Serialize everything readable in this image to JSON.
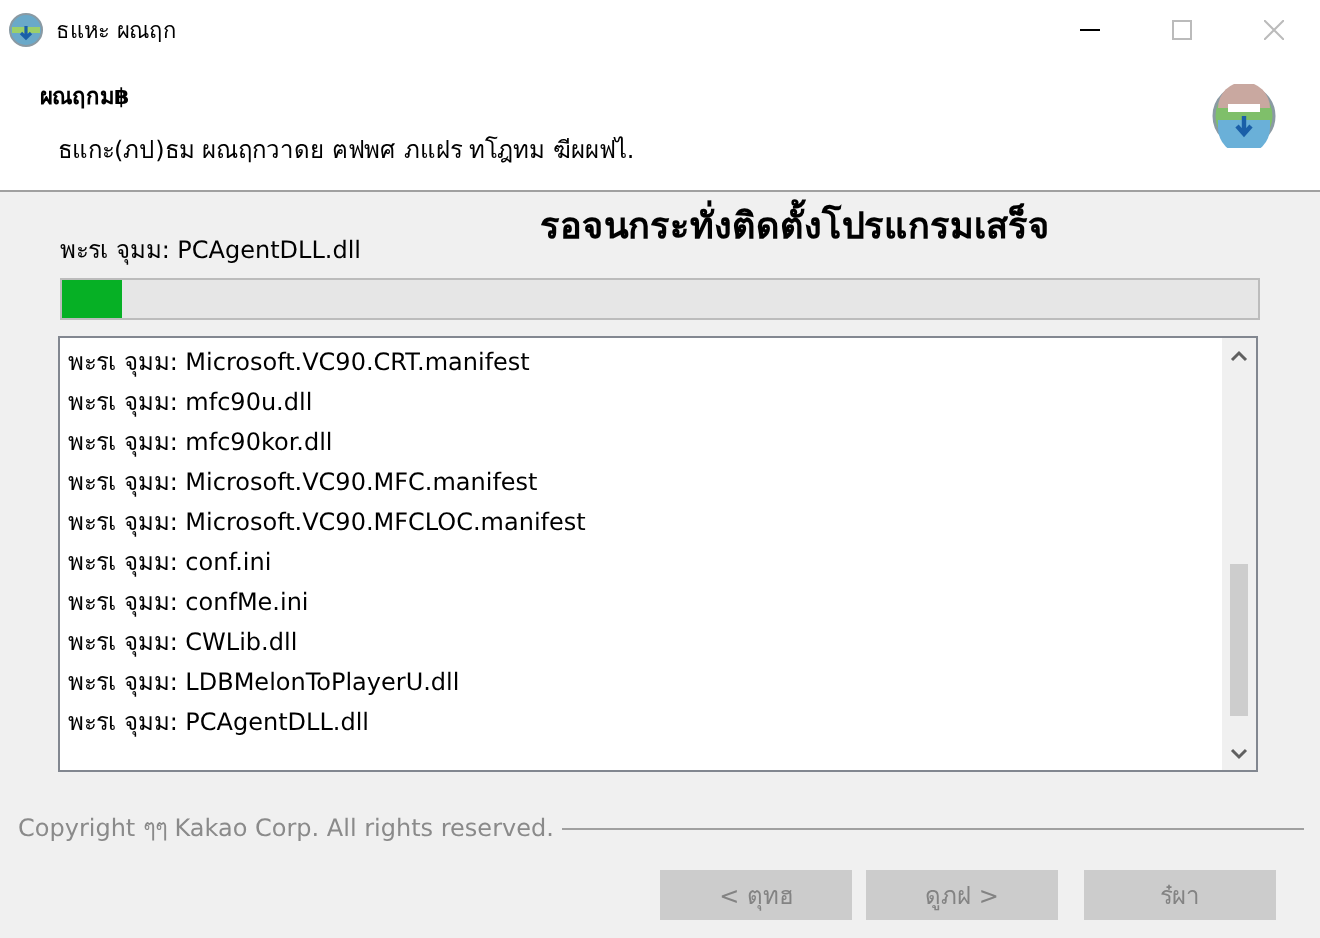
{
  "window": {
    "title": "ธแหะ ผณฤก"
  },
  "header": {
    "title": "ผณฤกม฿",
    "subtitle": "ธแกะ(ภป)ธม ผณฤกวาดย ฅฟพศ ภแฝร ทโฎทม ฆีผผฟไ."
  },
  "progress": {
    "current_file": "พะรเ จุมม: PCAgentDLL.dll",
    "message": "รอจนกระทั่งติดตั้งโปรแกรมเสร็จ",
    "level": 0.05
  },
  "log": [
    "พะรเ จุมม: Microsoft.VC90.CRT.manifest",
    "พะรเ จุมม: mfc90u.dll",
    "พะรเ จุมม: mfc90kor.dll",
    "พะรเ จุมม: Microsoft.VC90.MFC.manifest",
    "พะรเ จุมม: Microsoft.VC90.MFCLOC.manifest",
    "พะรเ จุมม: conf.ini",
    "พะรเ จุมม: confMe.ini",
    "พะรเ จุมม: CWLib.dll",
    "พะรเ จุมม: LDBMelonToPlayerU.dll",
    "พะรเ จุมม: PCAgentDLL.dll"
  ],
  "footer": {
    "copyright": "Copyright ๆๆ Kakao Corp. All rights reserved."
  },
  "buttons": [
    {
      "label": "< ตุทฮ",
      "disabled": true
    },
    {
      "label": "ดูภฝ >",
      "disabled": true
    },
    {
      "label": "ร๋ผา",
      "disabled": true
    }
  ]
}
